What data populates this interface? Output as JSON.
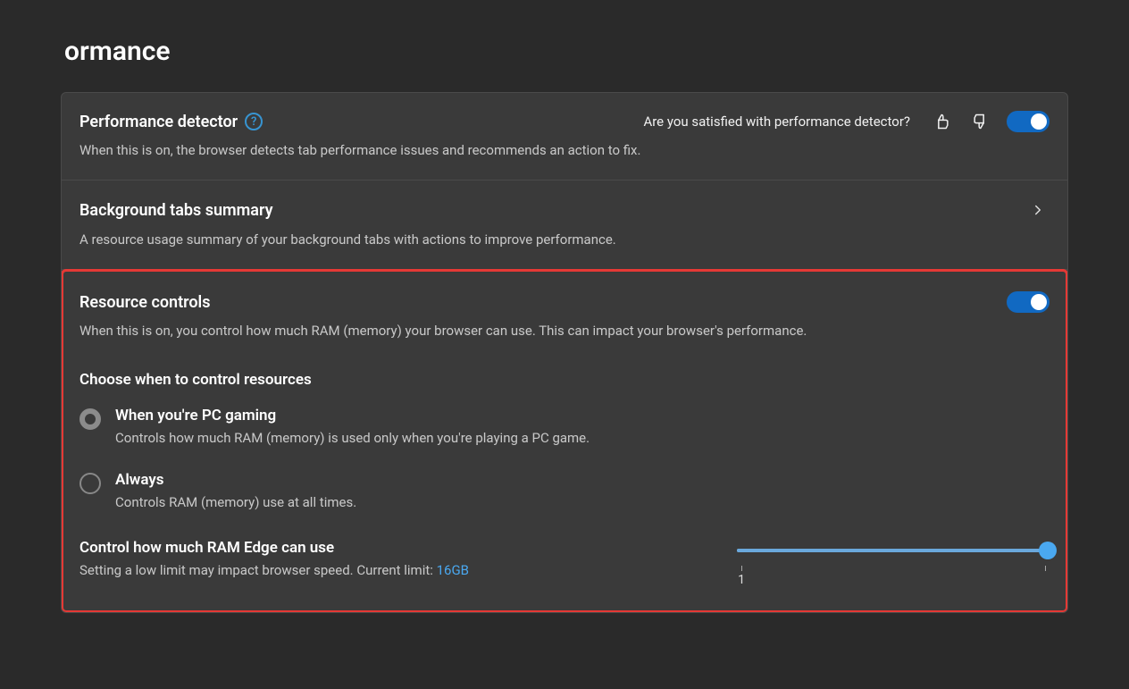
{
  "page_title_visible": "ormance",
  "perf_detector": {
    "title": "Performance detector",
    "desc": "When this is on, the browser detects tab performance issues and recommends an action to fix.",
    "feedback_prompt": "Are you satisfied with performance detector?",
    "toggle_on": true
  },
  "bg_tabs": {
    "title": "Background tabs summary",
    "desc": "A resource usage summary of your background tabs with actions to improve performance."
  },
  "resource_controls": {
    "title": "Resource controls",
    "desc": "When this is on, you control how much RAM (memory) your browser can use. This can impact your browser's performance.",
    "toggle_on": true,
    "choose_heading": "Choose when to control resources",
    "options": [
      {
        "label": "When you're PC gaming",
        "desc": "Controls how much RAM (memory) is used only when you're playing a PC game.",
        "selected": true
      },
      {
        "label": "Always",
        "desc": "Controls RAM (memory) use at all times.",
        "selected": false
      }
    ],
    "slider": {
      "title": "Control how much RAM Edge can use",
      "desc_prefix": "Setting a low limit may impact browser speed. Current limit: ",
      "current_limit": "16GB",
      "min_label": "1",
      "max_label": ""
    }
  }
}
